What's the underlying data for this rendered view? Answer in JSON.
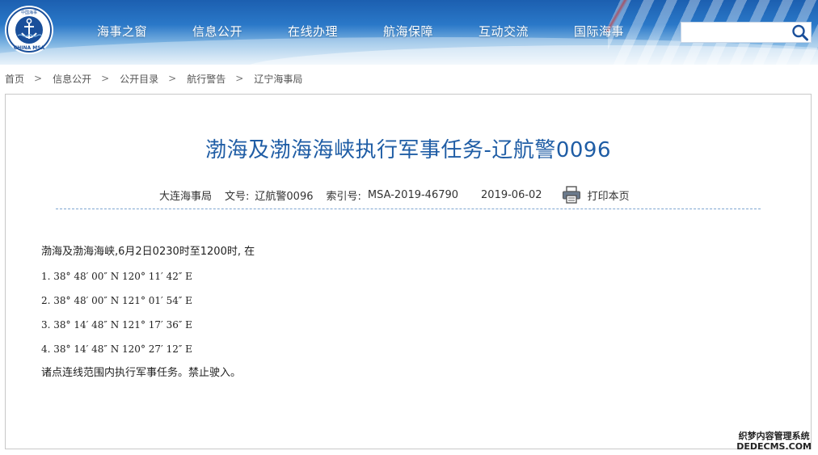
{
  "header": {
    "logo_text": "CHINA MSA",
    "logo_top_text": "中国海事",
    "nav": [
      "海事之窗",
      "信息公开",
      "在线办理",
      "航海保障",
      "互动交流",
      "国际海事"
    ],
    "search": {
      "value": "",
      "placeholder": ""
    }
  },
  "breadcrumb": [
    "首页",
    "信息公开",
    "公开目录",
    "航行警告",
    "辽宁海事局"
  ],
  "article": {
    "title": "渤海及渤海海峡执行军事任务-辽航警0096",
    "meta": {
      "issuer": "大连海事局",
      "doc_no_label": "文号:",
      "doc_no": "辽航警0096",
      "index_label": "索引号:",
      "index_no": "MSA-2019-46790",
      "date": "2019-06-02",
      "print_label": "打印本页"
    },
    "intro": "渤海及渤海海峡,6月2日0230时至1200时, 在",
    "coordinates": [
      "1. 38° 48′ 00″ N  120° 11′ 42″ E",
      "2. 38° 48′ 00″ N  121° 01′ 54″ E",
      "3. 38° 14′ 48″ N  121° 17′ 36″ E",
      "4. 38° 14′ 48″ N  120° 27′ 12″ E"
    ],
    "outro": "诸点连线范围内执行军事任务。禁止驶入。"
  },
  "watermark": {
    "line1": "织梦内容管理系统",
    "line2": "DEDECMS.COM"
  },
  "colors": {
    "title": "#1f5da5",
    "header_top": "#1c5fb0",
    "divider": "#7fa6d2"
  }
}
